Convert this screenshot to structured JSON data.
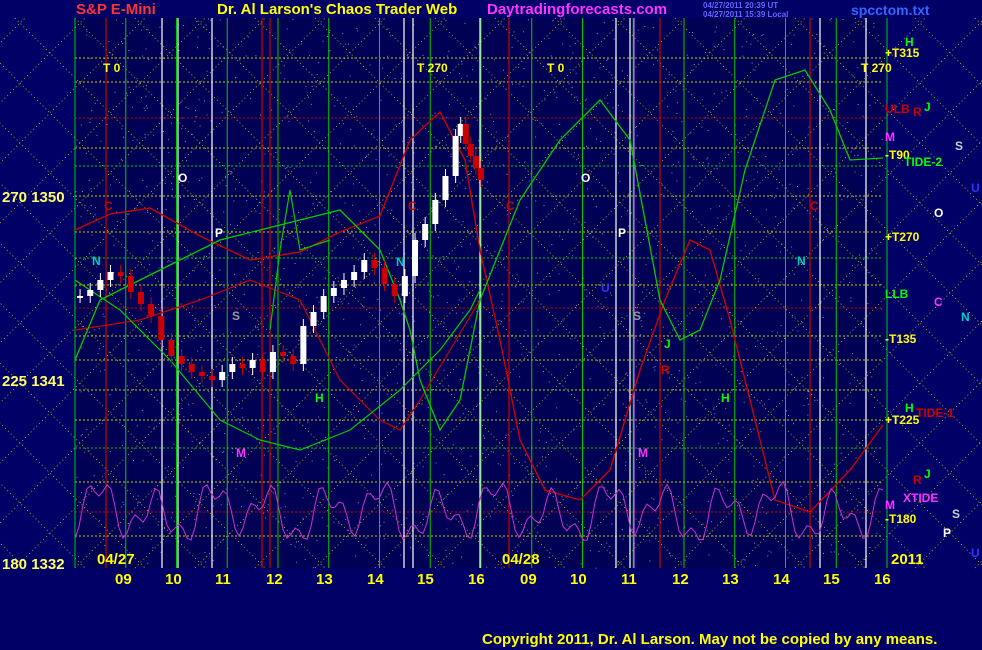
{
  "header": {
    "instrument": "S&P E-Mini",
    "title": "Dr. Al Larson's Chaos Trader Web",
    "site": "Daytradingforecasts.com",
    "stamp_line1": "04/27/2011 20:39 UT",
    "stamp_line2": "04/27/2011 15:39 Local",
    "file": "spcctom.txt"
  },
  "footer": {
    "copyright": "Copyright 2011, Dr. Al Larson. May not be copied by any means."
  },
  "colors": {
    "background": "#000066",
    "plot_bg": "#000055",
    "price": "#ffffff",
    "grid_green": "#00cc00",
    "grid_yellow": "#cccc00",
    "red": "#cc0000",
    "green_curve": "#00cc00",
    "magenta": "#cc33cc",
    "white": "#ffffff",
    "title_yellow": "#ffff00",
    "title_magenta": "#ff33ff"
  },
  "chart_data": {
    "type": "candlestick",
    "title": "Dr. Al Larson's Chaos Trader Web",
    "instrument": "S&P E-Mini",
    "y_ticks": [
      {
        "label": "270 1350",
        "value": 1350
      },
      {
        "label": "225 1341",
        "value": 1341
      },
      {
        "label": "180 1332",
        "value": 1332
      }
    ],
    "ylim": [
      1332,
      1350
    ],
    "date_labels": [
      "04/27",
      "04/28"
    ],
    "year_label": "2011",
    "x_ticks": [
      "09",
      "10",
      "11",
      "12",
      "13",
      "14",
      "15",
      "16",
      "09",
      "10",
      "11",
      "12",
      "13",
      "14",
      "15",
      "16"
    ],
    "t_labels": [
      {
        "text": "T  0",
        "slot": 0
      },
      {
        "text": "T  270",
        "slot": 1
      },
      {
        "text": "T  0",
        "slot": 2
      },
      {
        "text": "T  270",
        "slot": 3
      }
    ],
    "right_labels": [
      {
        "text": "+T315",
        "color": "#ffff00"
      },
      {
        "text": "ULB",
        "color": "#cc0000"
      },
      {
        "text": "M",
        "color": "#ff33ff"
      },
      {
        "text": "-T90",
        "color": "#ffff00"
      },
      {
        "text": "+T270",
        "color": "#ffff00"
      },
      {
        "text": "LLB",
        "color": "#00ff00"
      },
      {
        "text": "-T135",
        "color": "#ffff00"
      },
      {
        "text": "+T225",
        "color": "#ffff00"
      },
      {
        "text": "M",
        "color": "#ff33ff"
      },
      {
        "text": "-T180",
        "color": "#ffff00"
      }
    ],
    "planet_labels": [
      {
        "text": "H",
        "color": "#00ff00"
      },
      {
        "text": "R",
        "color": "#cc0000"
      },
      {
        "text": "J",
        "color": "#00ff00"
      },
      {
        "text": "S",
        "color": "#cccccc"
      },
      {
        "text": "TIDE-2",
        "color": "#00ff00"
      },
      {
        "text": "U",
        "color": "#3333ff"
      },
      {
        "text": "O",
        "color": "#ffffff"
      },
      {
        "text": "C",
        "color": "#ff33ff"
      },
      {
        "text": "N",
        "color": "#00cccc"
      },
      {
        "text": "H",
        "color": "#00ff00"
      },
      {
        "text": "TIDE-1",
        "color": "#cc0000"
      },
      {
        "text": "R",
        "color": "#cc0000"
      },
      {
        "text": "J",
        "color": "#00ff00"
      },
      {
        "text": "XTIDE",
        "color": "#ff33ff"
      },
      {
        "text": "S",
        "color": "#cccccc"
      },
      {
        "text": "P",
        "color": "#ffffff"
      },
      {
        "text": "U",
        "color": "#3333ff"
      }
    ],
    "in_chart_labels": [
      {
        "text": "C",
        "color": "#cc0000"
      },
      {
        "text": "O",
        "color": "#ffffff"
      },
      {
        "text": "N",
        "color": "#00cccc"
      },
      {
        "text": "P",
        "color": "#ffffff"
      },
      {
        "text": "S",
        "color": "#999999"
      },
      {
        "text": "H",
        "color": "#00ff00"
      },
      {
        "text": "M",
        "color": "#ff33ff"
      },
      {
        "text": "C",
        "color": "#cc0000"
      },
      {
        "text": "N",
        "color": "#00cccc"
      },
      {
        "text": "C",
        "color": "#cc0000"
      },
      {
        "text": "O",
        "color": "#ffffff"
      },
      {
        "text": "P",
        "color": "#ffffff"
      },
      {
        "text": "U",
        "color": "#3333ff"
      },
      {
        "text": "S",
        "color": "#999999"
      },
      {
        "text": "R",
        "color": "#cc0000"
      },
      {
        "text": "J",
        "color": "#00ff00"
      },
      {
        "text": "H",
        "color": "#00ff00"
      },
      {
        "text": "M",
        "color": "#ff33ff"
      },
      {
        "text": "N",
        "color": "#00cccc"
      },
      {
        "text": "C",
        "color": "#cc0000"
      }
    ],
    "price_series": {
      "name": "S&P E-Mini",
      "x_hours": [
        8.1,
        8.3,
        8.5,
        8.7,
        8.9,
        9.1,
        9.3,
        9.5,
        9.7,
        9.9,
        10.1,
        10.3,
        10.5,
        10.7,
        10.9,
        11.1,
        11.3,
        11.5,
        11.7,
        11.9,
        12.1,
        12.3,
        12.5,
        12.7,
        12.9,
        13.1,
        13.3,
        13.5,
        13.7,
        13.9,
        14.1,
        14.3,
        14.5,
        14.7,
        14.9,
        15.1,
        15.3,
        15.5,
        15.6,
        15.7,
        15.8,
        15.9,
        16.0
      ],
      "close": [
        1345.0,
        1345.3,
        1345.8,
        1346.2,
        1346.0,
        1345.2,
        1344.6,
        1344.0,
        1342.8,
        1342.0,
        1341.6,
        1341.2,
        1341.0,
        1340.8,
        1341.2,
        1341.6,
        1341.4,
        1341.8,
        1341.2,
        1342.2,
        1342.0,
        1341.6,
        1343.5,
        1344.2,
        1345.0,
        1345.4,
        1345.8,
        1346.2,
        1346.8,
        1346.4,
        1345.6,
        1345.0,
        1346.0,
        1347.8,
        1348.6,
        1349.8,
        1351.0,
        1353.0,
        1353.6,
        1352.6,
        1352.0,
        1351.4,
        1350.8
      ]
    }
  }
}
